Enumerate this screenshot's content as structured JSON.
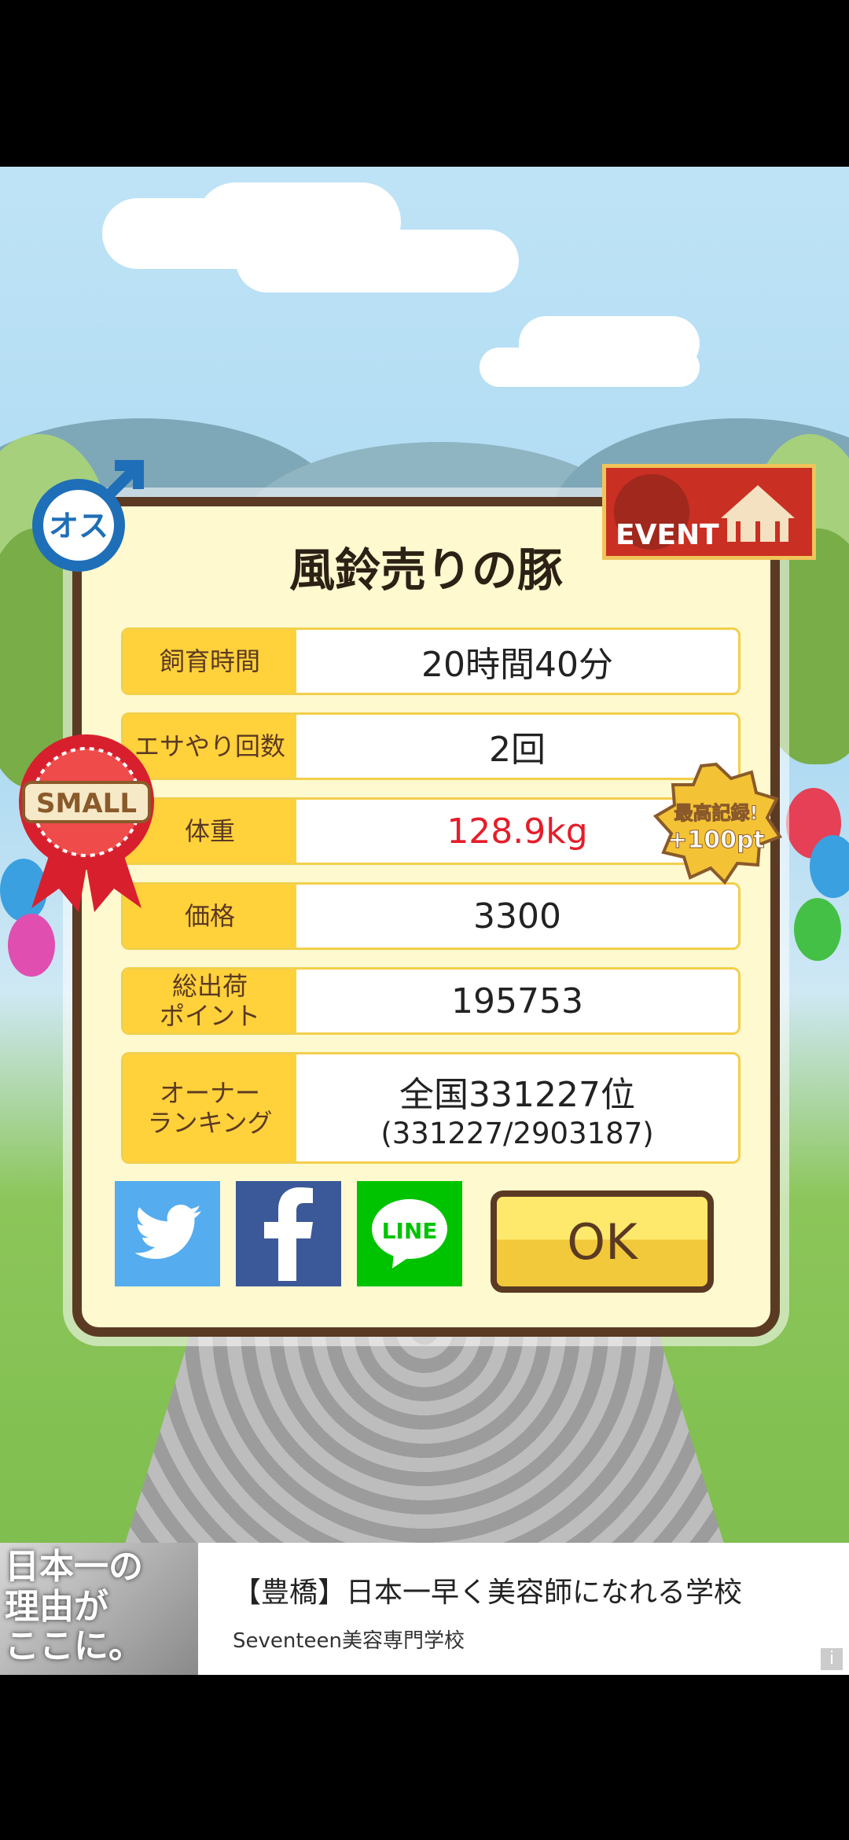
{
  "dialog": {
    "title": "風鈴売りの豚",
    "rows": [
      {
        "label": "飼育時間",
        "value": "20時間40分"
      },
      {
        "label": "エサやり回数",
        "value": "2回"
      },
      {
        "label": "体重",
        "value": "128.9kg"
      },
      {
        "label": "価格",
        "value": "3300"
      },
      {
        "label": "総出荷\nポイント",
        "value": "195753"
      },
      {
        "label": "オーナー\nランキング",
        "value": "全国331227位",
        "sub": "(331227/2903187)"
      }
    ],
    "ok_label": "OK",
    "share": {
      "twitter": "twitter-icon",
      "facebook": "facebook-icon",
      "line_label": "LINE"
    }
  },
  "badges": {
    "gender": "オス",
    "event": "EVENT",
    "size": "SMALL",
    "record_line1": "最高記録!",
    "record_line2": "+100pt"
  },
  "ad": {
    "image_text": "日本一の\n理由が\nここに。",
    "title": "【豊橋】日本一早く美容師になれる学校",
    "sponsor": "Seventeen美容専門学校",
    "info": "i"
  },
  "colors": {
    "frame": "#5b3a23",
    "panel": "#fff9cf",
    "label_bg": "#ffd13b",
    "weight_red": "#e51d2a",
    "twitter": "#55acee",
    "facebook": "#3b5998",
    "line": "#00c300"
  }
}
